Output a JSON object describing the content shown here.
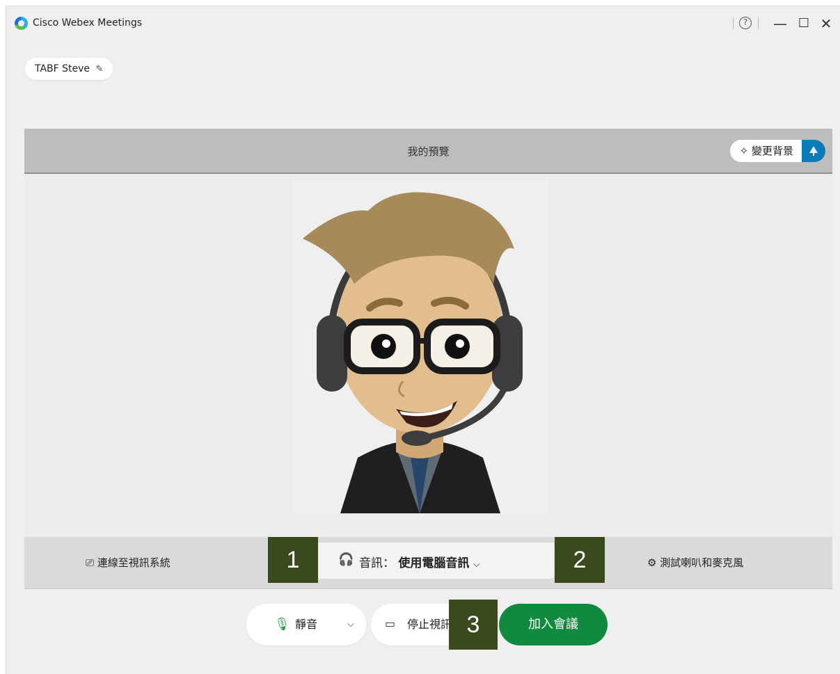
{
  "window": {
    "title": "Cisco Webex Meetings",
    "help_glyph": "?",
    "minimize_glyph": "—",
    "maximize_glyph": "☐",
    "close_glyph": "✕"
  },
  "user": {
    "name": "TABF Steve",
    "edit_icon": "pencil-icon"
  },
  "preview": {
    "title": "我的預覽",
    "change_background_label": "變更背景",
    "blur_icon": "blur-background-icon"
  },
  "devices": {
    "connect_video_label": "連線至視訊系統",
    "audio_prefix": "音訊：",
    "audio_value": "使用電腦音訊",
    "test_label": "測試喇叭和麥克風"
  },
  "controls": {
    "mute_label": "靜音",
    "video_label": "停止視訊",
    "join_label": "加入會議"
  },
  "badges": [
    "1",
    "2",
    "3"
  ],
  "colors": {
    "join": "#108a3f",
    "badge": "#3b4a1c",
    "blur_toggle": "#0a7cb8",
    "mic": "#2e9b4f"
  }
}
